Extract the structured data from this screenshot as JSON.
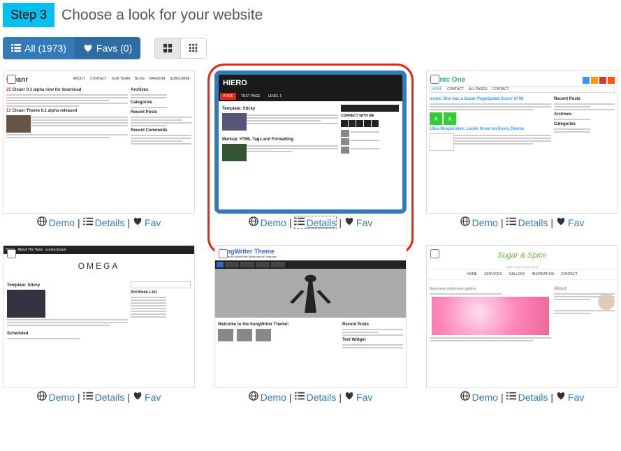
{
  "step": {
    "label": "Step 3",
    "title": "Choose a look for your website"
  },
  "filters": {
    "all": "All (1973)",
    "favs": "Favs (0)"
  },
  "themes": [
    {
      "name": "Cleanr",
      "demo": "Demo",
      "details": "Details",
      "fav": "Fav",
      "selected": false,
      "blocks": {
        "t1": "Cleanr 0.1 alpha now for download",
        "t2": "Cleanr Theme 0.1 alpha released",
        "s1": "Archives",
        "s2": "Categories",
        "s3": "Recent Posts",
        "s4": "Recent Comments",
        "n25": "25",
        "n12": "12"
      }
    },
    {
      "name": "HIERO",
      "demo": "Demo",
      "details": "Details",
      "fav": "Fav",
      "selected": true,
      "blocks": {
        "t1": "Template: Sticky",
        "t2": "Markup: HTML Tags and Formatting",
        "side": "CONNECT WITH ME",
        "nav_home": "HOME",
        "nav_2": "TEST PAGE",
        "nav_3": "LEVEL 1"
      }
    },
    {
      "name": "Iconic One",
      "demo": "Demo",
      "details": "Details",
      "fav": "Fav",
      "selected": false,
      "blocks": {
        "t1": "Iconic One has a Super PageSpeed Score of 96",
        "t2": "Ultra Responsive, Looks Great on Every Device",
        "s1": "Recent Posts",
        "s2": "Archives",
        "s3": "Categories"
      }
    },
    {
      "name": "OMEGA",
      "demo": "Demo",
      "details": "Details",
      "fav": "Fav",
      "selected": false,
      "blocks": {
        "t1": "Template: Sticky",
        "t2": "Scheduled",
        "s1": "Archives List"
      }
    },
    {
      "name": "SongWriter Theme",
      "demo": "Demo",
      "details": "Details",
      "fav": "Fav",
      "selected": false,
      "blocks": {
        "sub": "Responsive WordPress Multipurpose Template",
        "t1": "Welcome to the SongWriter Theme!",
        "s1": "Recent Posts",
        "s2": "Text Widget"
      }
    },
    {
      "name": "Sugar & Spice",
      "demo": "Demo",
      "details": "Details",
      "fav": "Fav",
      "selected": false,
      "blocks": {
        "sub": "AND EVERYTHING NICE",
        "t1": "Awesome slideshow gallery",
        "s1": "About"
      }
    }
  ]
}
